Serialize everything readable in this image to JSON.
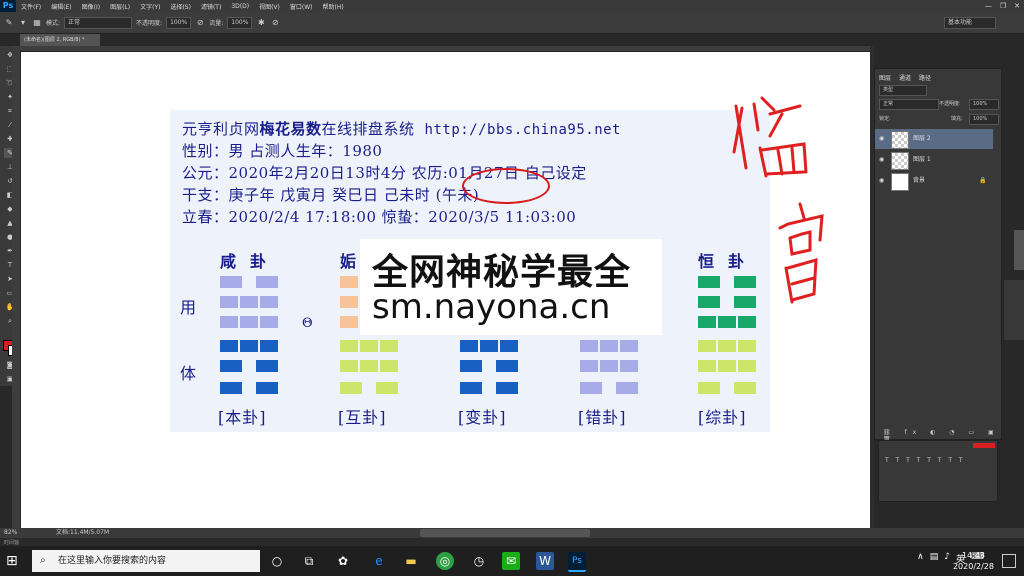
{
  "app": {
    "logo": "Ps",
    "menus": [
      "文件(F)",
      "编辑(E)",
      "图像(I)",
      "图层(L)",
      "文字(Y)",
      "选择(S)",
      "滤镜(T)",
      "3D(D)",
      "视图(V)",
      "窗口(W)",
      "帮助(H)"
    ],
    "window_controls": [
      "—",
      "❐",
      "✕"
    ]
  },
  "options_bar": {
    "mode_label": "模式:",
    "mode_value": "正常",
    "opacity_label": "不透明度:",
    "opacity_value": "100%",
    "flow_label": "流量:",
    "flow_value": "100%",
    "workspace": "基本功能"
  },
  "document": {
    "tab_title": "(未命名)(图层 2, RGB/8) *"
  },
  "image": {
    "header": {
      "prefix": "元亨利贞网",
      "bold": "梅花易数",
      "suffix": "在线排盘系统",
      "url": "http://bbs.china95.net"
    },
    "line2": "性别：男  占测人生年：1980",
    "line3": "公元：2020年2月20日13时4分  农历:01月27日  自己设定",
    "line4": "干支：庚子年  戊寅月  癸巳日  己未时  (午未)",
    "line5": "立春：2020/2/4 17:18:00  惊蛰：2020/3/5 11:03:00",
    "side_labels": [
      "用",
      "体"
    ],
    "gua_names": [
      "咸卦",
      "姤",
      "恒卦"
    ],
    "gua_labels": [
      "[本卦]",
      "[互卦]",
      "[变卦]",
      "[错卦]",
      "[综卦]"
    ],
    "moving_marker": "Θ",
    "watermark_line1": "全网神秘学最全",
    "watermark_line2": "sm.nayona.cn",
    "handwriting": "临官"
  },
  "hexagrams": [
    {
      "name": "本卦",
      "lines": [
        {
          "yin": true,
          "color": "#a7abe8"
        },
        {
          "yin": false,
          "color": "#a7abe8"
        },
        {
          "yin": false,
          "color": "#a7abe8"
        },
        {
          "yin": false,
          "color": "#1a5fc4"
        },
        {
          "yin": true,
          "color": "#1a5fc4"
        },
        {
          "yin": true,
          "color": "#1a5fc4"
        }
      ]
    },
    {
      "name": "互卦",
      "lines": [
        {
          "yin": false,
          "color": "#f6c39a"
        },
        {
          "yin": false,
          "color": "#f6c39a"
        },
        {
          "yin": false,
          "color": "#f6c39a"
        },
        {
          "yin": false,
          "color": "#cde66a"
        },
        {
          "yin": false,
          "color": "#cde66a"
        },
        {
          "yin": true,
          "color": "#cde66a"
        }
      ]
    },
    {
      "name": "变卦",
      "lines": [
        {
          "yin": true,
          "color": "#1a5fc4"
        },
        {
          "yin": false,
          "color": "#1a5fc4"
        },
        {
          "yin": false,
          "color": "#1a5fc4"
        },
        {
          "yin": false,
          "color": "#1a5fc4"
        },
        {
          "yin": true,
          "color": "#1a5fc4"
        },
        {
          "yin": true,
          "color": "#1a5fc4"
        }
      ]
    },
    {
      "name": "错卦",
      "lines": [
        {
          "yin": true,
          "color": "#a7abe8"
        },
        {
          "yin": true,
          "color": "#a7abe8"
        },
        {
          "yin": false,
          "color": "#a7abe8"
        },
        {
          "yin": false,
          "color": "#a7abe8"
        },
        {
          "yin": false,
          "color": "#a7abe8"
        },
        {
          "yin": true,
          "color": "#a7abe8"
        }
      ]
    },
    {
      "name": "综卦",
      "lines": [
        {
          "yin": true,
          "color": "#1aa86a"
        },
        {
          "yin": true,
          "color": "#1aa86a"
        },
        {
          "yin": false,
          "color": "#1aa86a"
        },
        {
          "yin": false,
          "color": "#cde66a"
        },
        {
          "yin": false,
          "color": "#cde66a"
        },
        {
          "yin": true,
          "color": "#cde66a"
        }
      ]
    }
  ],
  "layers_panel": {
    "tabs": [
      "图层",
      "通道",
      "路径"
    ],
    "kind": "类型",
    "blend": "正常",
    "opacity_label": "不透明度:",
    "opacity_value": "100%",
    "lock_label": "锁定:",
    "fill_label": "填充:",
    "fill_value": "100%",
    "layers": [
      {
        "name": "图层 2",
        "selected": true
      },
      {
        "name": "图层 1",
        "selected": false
      },
      {
        "name": "背景",
        "selected": false
      }
    ]
  },
  "status_bar": {
    "zoom": "82%",
    "doc_info": "文档:11.4M/5.07M",
    "timeline": "时间轴"
  },
  "taskbar": {
    "search_placeholder": "在这里输入你要搜索的内容",
    "time": "14:43",
    "date": "2020/2/28",
    "ime": "英"
  }
}
